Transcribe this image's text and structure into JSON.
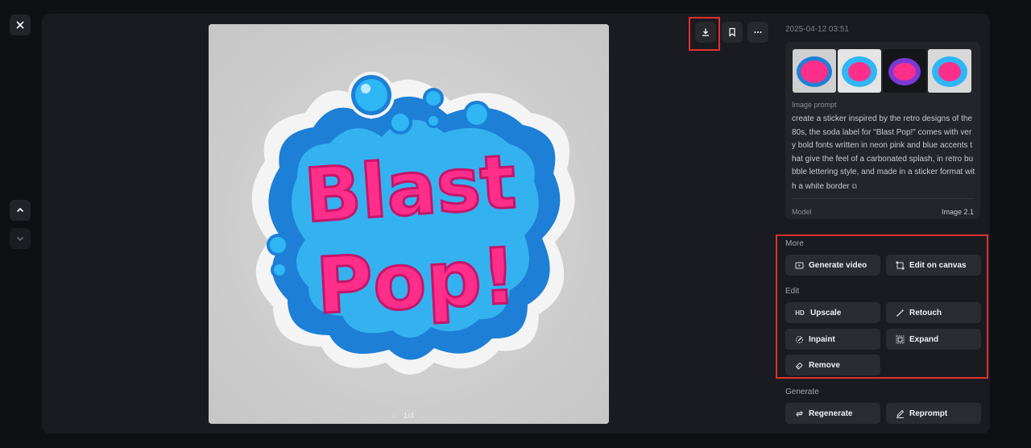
{
  "viewer": {
    "pager": "1/4",
    "image_text": "Blast Pop!"
  },
  "details": {
    "timestamp": "2025-04-12 03:51",
    "prompt_label": "Image prompt",
    "prompt": "create a sticker inspired by the retro designs of the 80s, the soda label for \"Blast Pop!\" comes with very bold fonts written in neon pink and blue accents that give the feel of a carbonated splash, in retro bubble lettering style, and made in a sticker format with a white border",
    "model_label": "Model",
    "model_value": "Image 2.1"
  },
  "more": {
    "title": "More",
    "generate_video": "Generate video",
    "edit_on_canvas": "Edit on canvas"
  },
  "edit": {
    "title": "Edit",
    "upscale_badge": "HD",
    "upscale": "Upscale",
    "retouch": "Retouch",
    "inpaint": "Inpaint",
    "expand": "Expand",
    "remove": "Remove"
  },
  "generate": {
    "title": "Generate",
    "regenerate": "Regenerate",
    "reprompt": "Reprompt"
  },
  "colors": {
    "accent_pink": "#ff2e8a",
    "accent_blue": "#1d8fe6",
    "highlight_red": "#e03030"
  }
}
